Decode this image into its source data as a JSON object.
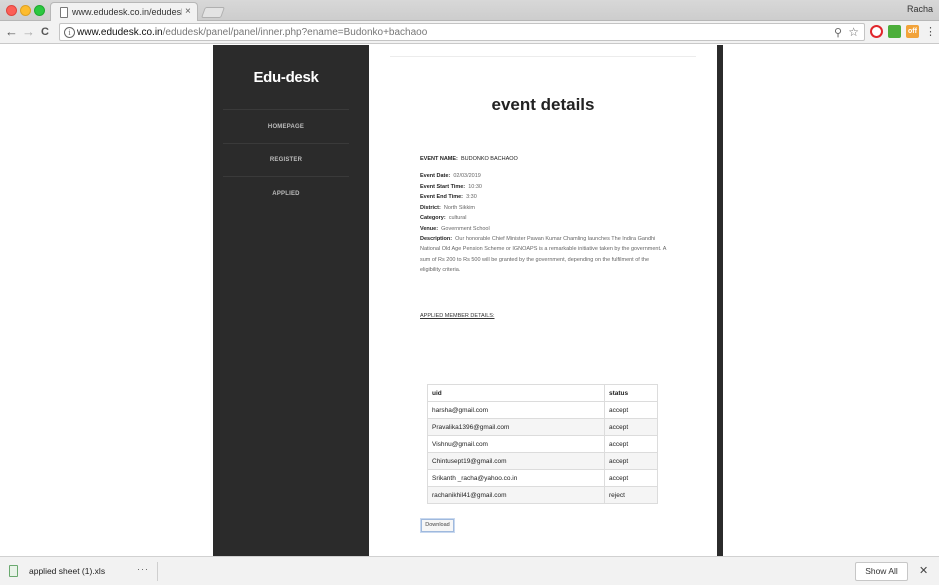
{
  "browser": {
    "tab_title": "www.edudesk.co.in/edudesk/p",
    "tab_close": "×",
    "profile_name": "Racha",
    "url_host": "www.edudesk.co.in",
    "url_path": "/edudesk/panel/panel/inner.php?ename=Budonko+bachaoo",
    "icons": {
      "back": "back-arrow-icon",
      "forward": "forward-arrow-icon",
      "reload": "reload-icon",
      "info": "info-icon",
      "search": "search-icon",
      "star": "star-icon",
      "menu": "menu-icon"
    },
    "back_glyph": "←",
    "forward_glyph": "→",
    "reload_glyph": "C",
    "info_glyph": "i",
    "search_glyph": "⚲",
    "star_glyph": "☆",
    "menu_glyph": "⋮",
    "ext_shop_label": "off"
  },
  "sidebar": {
    "brand": "Edu-desk",
    "items": [
      {
        "label": "HOMEPAGE"
      },
      {
        "label": "REGISTER"
      },
      {
        "label": "APPLIED"
      }
    ]
  },
  "main": {
    "title": "event details",
    "event_name_label": "EVENT NAME:",
    "event_name_value": "BUDONKO BACHAOO",
    "details": [
      {
        "label": "Event Date:",
        "value": "02/03/2019"
      },
      {
        "label": "Event Start Time:",
        "value": "10:30"
      },
      {
        "label": "Event End Time:",
        "value": "3:30"
      },
      {
        "label": "District:",
        "value": "North Sikkim"
      },
      {
        "label": "Category:",
        "value": "cultural"
      },
      {
        "label": "Venue:",
        "value": "Government School"
      }
    ],
    "description_label": "Description:",
    "description_value": "Our honorable Chief Minister Pawan Kumar Chamling launches The Indira Gandhi National Old Age Pension Scheme or IGNOAPS is a remarkable initiative taken by the government. A sum of Rs 200 to Rs 500 will be granted by the government, depending on the fulfilment of the eligibility criteria.",
    "applied_heading": "APPLIED MEMBER DETAILS:",
    "table": {
      "headers": [
        "uid",
        "status"
      ],
      "rows": [
        [
          "harsha@gmail.com",
          "accept"
        ],
        [
          "Pravalika1396@gmail.com",
          "accept"
        ],
        [
          "Vishnu@gmail.com",
          "accept"
        ],
        [
          "Chintusept19@gmail.com",
          "accept"
        ],
        [
          "Srikanth _racha@yahoo.co.in",
          "accept"
        ],
        [
          "rachanikhil41@gmail.com",
          "reject"
        ]
      ]
    },
    "download_label": "Download"
  },
  "download_shelf": {
    "file_name": "applied sheet (1).xls",
    "more_glyph": "···",
    "show_all_label": "Show All",
    "close_glyph": "✕"
  }
}
